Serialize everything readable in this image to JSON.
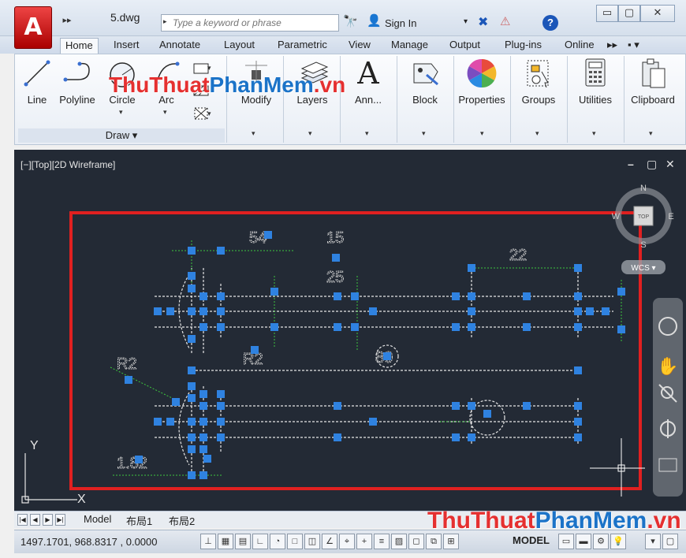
{
  "window": {
    "document_title": "5.dwg",
    "app_logo": "A",
    "qat_expand": "▸▸",
    "search": {
      "placeholder": "Type a keyword or phrase",
      "arrow": "▸"
    },
    "signin_label": "Sign In",
    "help_glyph": "?",
    "controls": {
      "minimize": "▭",
      "maximize": "▢",
      "close": "✕"
    }
  },
  "ribbon_tabs": [
    {
      "label": "Home",
      "active": true
    },
    {
      "label": "Insert"
    },
    {
      "label": "Annotate"
    },
    {
      "label": "Layout"
    },
    {
      "label": "Parametric"
    },
    {
      "label": "View"
    },
    {
      "label": "Manage"
    },
    {
      "label": "Output"
    },
    {
      "label": "Plug-ins"
    },
    {
      "label": "Online"
    },
    {
      "label": "▸▸"
    },
    {
      "label": "▪ ▾"
    }
  ],
  "ribbon": {
    "draw_tools": [
      {
        "label": "Line",
        "icon": "line-icon"
      },
      {
        "label": "Polyline",
        "icon": "polyline-icon"
      },
      {
        "label": "Circle",
        "icon": "circle-icon"
      },
      {
        "label": "Arc",
        "icon": "arc-icon"
      }
    ],
    "draw_panel_title": "Draw ▾",
    "panels": [
      {
        "label": "Modify",
        "icon": "modify-icon"
      },
      {
        "label": "Layers",
        "icon": "layers-icon"
      },
      {
        "label": "Ann...",
        "icon": "annotation-icon",
        "glyph": "A"
      },
      {
        "label": "Block",
        "icon": "block-icon"
      },
      {
        "label": "Properties",
        "icon": "properties-icon"
      },
      {
        "label": "Groups",
        "icon": "groups-icon"
      },
      {
        "label": "Utilities",
        "icon": "utilities-icon"
      },
      {
        "label": "Clipboard",
        "icon": "clipboard-icon"
      }
    ]
  },
  "viewport": {
    "label": "[−][Top][2D Wireframe]",
    "controls": {
      "minimize": "–",
      "restore": "▢",
      "close": "✕"
    },
    "viewcube": {
      "north": "N",
      "south": "S",
      "east": "E",
      "west": "W",
      "face": "TOP",
      "wcs": "WCS ▾"
    },
    "ucs": {
      "y": "Y",
      "x": "X"
    },
    "dimensions": [
      "54",
      "15",
      "25",
      "22",
      "R2",
      "R2",
      "80",
      "1.82"
    ]
  },
  "colors": {
    "canvas": "#232a35",
    "grip": "#2f82e0",
    "dim_line": "#3ec73e",
    "selection_box": "#e02020"
  },
  "layout_tabs": {
    "nav": [
      "|◀",
      "◀",
      "▶",
      "▶|"
    ],
    "tabs": [
      "Model",
      "布局1",
      "布局2"
    ]
  },
  "status_bar": {
    "coordinates": "1497.1701, 968.8317 , 0.0000",
    "model_label": "MODEL"
  },
  "watermark": {
    "part1": "ThuThuat",
    "part2": "PhanMem",
    "part3": ".vn"
  }
}
